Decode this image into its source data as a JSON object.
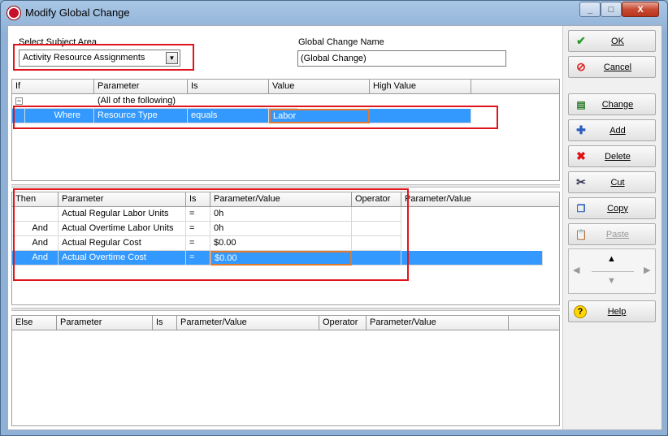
{
  "window": {
    "title": "Modify Global Change",
    "min": "_",
    "max": "□",
    "close": "X"
  },
  "subject": {
    "label": "Select Subject Area",
    "value": "Activity Resource Assignments"
  },
  "gcname": {
    "label": "Global Change Name",
    "value": "(Global Change)"
  },
  "ifgrid": {
    "headers": [
      "If",
      "Parameter",
      "Is",
      "Value",
      "High Value"
    ],
    "row0": {
      "expander": "−",
      "param": "(All of the following)"
    },
    "row1": {
      "if": "Where",
      "param": "Resource Type",
      "is": "equals",
      "value": "Labor"
    }
  },
  "thengrid": {
    "headers": [
      "Then",
      "Parameter",
      "Is",
      "Parameter/Value",
      "Operator",
      "Parameter/Value"
    ],
    "rows": [
      {
        "then": "",
        "param": "Actual Regular Labor Units",
        "is": "=",
        "value": "0h"
      },
      {
        "then": "And",
        "param": "Actual Overtime Labor Units",
        "is": "=",
        "value": "0h"
      },
      {
        "then": "And",
        "param": "Actual Regular Cost",
        "is": "=",
        "value": "$0.00"
      },
      {
        "then": "And",
        "param": "Actual Overtime Cost",
        "is": "=",
        "value": "$0.00"
      }
    ]
  },
  "elsegrid": {
    "headers": [
      "Else",
      "Parameter",
      "Is",
      "Parameter/Value",
      "Operator",
      "Parameter/Value"
    ]
  },
  "buttons": {
    "ok": "OK",
    "cancel": "Cancel",
    "change": "Change",
    "add": "Add",
    "delete": "Delete",
    "cut": "Cut",
    "copy": "Copy",
    "paste": "Paste",
    "help": "Help"
  },
  "colors": {
    "selection": "#3399ff",
    "highlight_box": "#e0151b"
  }
}
